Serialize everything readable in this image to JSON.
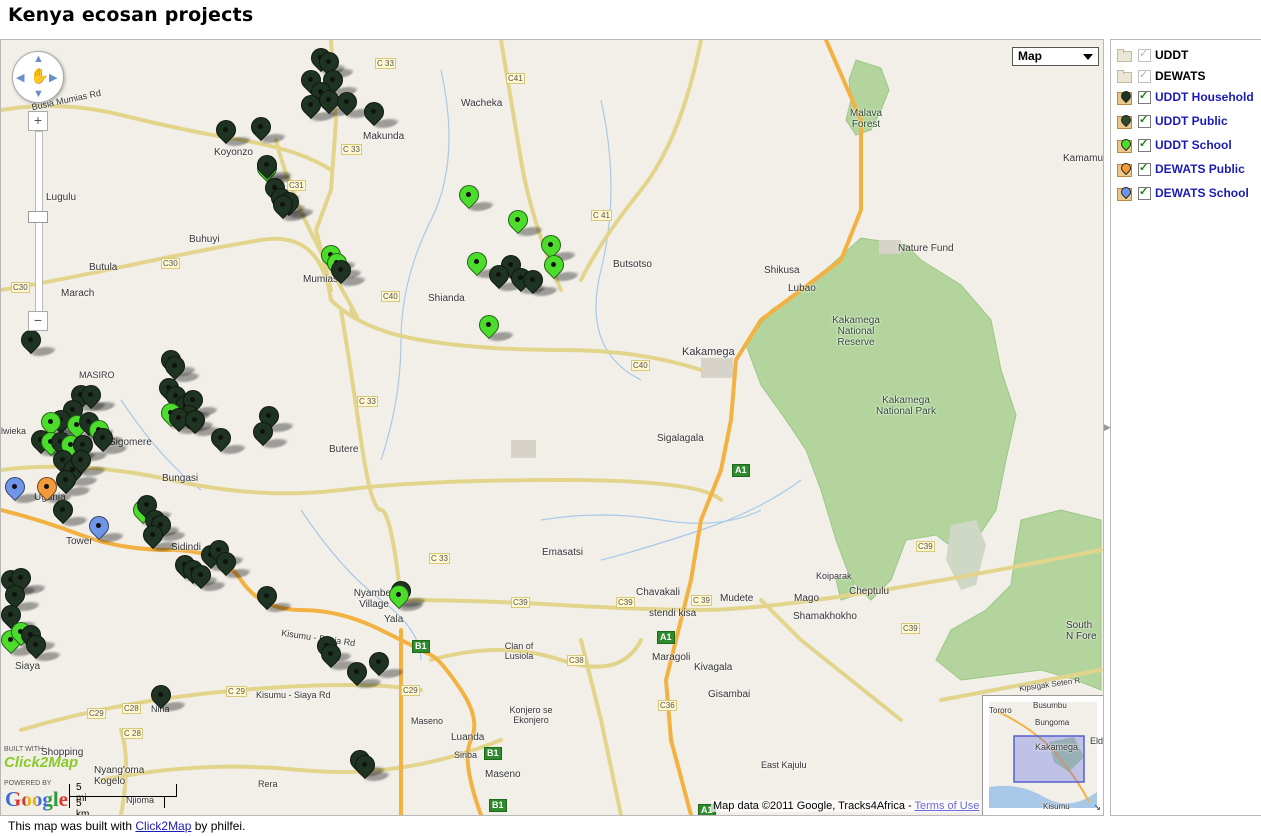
{
  "title": "Kenya ecosan projects",
  "colors": {
    "uddt_household": "#1f3322",
    "uddt_public": "#2a4a2a",
    "uddt_school": "#4cdc2c",
    "dewats_public": "#f39a3a",
    "dewats_school": "#6f95e8",
    "forest": "#b3d49d",
    "highway": "#f2b140",
    "road": "#fff3a3"
  },
  "map": {
    "type_selector": "Map",
    "attribution": "Map data ©2011 Google, Tracks4Africa - ",
    "terms_link": "Terms of Use",
    "scale_mi": "5 mi",
    "scale_km": "5 km",
    "built_with": "BUILT WITH",
    "click2map_logo": "Click2Map",
    "powered_by": "POWERED BY",
    "google_logo": "Google",
    "overview_labels": [
      "Busumbu",
      "Tororo",
      "Bungoma",
      "Kakamega",
      "Eld",
      "Kisumu"
    ],
    "places": [
      "Wacheka",
      "Makunda",
      "Koyonzo",
      "Lugulu",
      "Buhuyi",
      "Butula",
      "Marach",
      "Mumias",
      "Shianda",
      "Butsotso",
      "Lubao",
      "Shikusa",
      "Nature Fund",
      "Malava Forest",
      "Kamamu",
      "Kakamega",
      "Kakamega National Reserve",
      "Kakamega National Park",
      "MASIRO",
      "Sigomere",
      "Bungasi",
      "Butere",
      "Sigalagala",
      "Ugunja",
      "Tower",
      "Sidindi",
      "Siaya",
      "Nyamber Village",
      "Yala",
      "Emasatsi",
      "Chavakali",
      "Mudete",
      "Mago",
      "Cheptulu",
      "Koiparak",
      "Shamakhokho",
      "stendi kisa",
      "Clan of Lusiola",
      "Maragoli",
      "Kivagala",
      "Gisambai",
      "Maseno",
      "Luanda",
      "Konjero se Ekonjero",
      "Siriba",
      "Maseno",
      "East Kajulu",
      "South N Fore",
      "Nyang'oma Kogelo",
      "Shopping",
      "Rera",
      "Nina",
      "lwieka",
      "Kipsigak Seten R",
      "Njioma"
    ],
    "roads": [
      "C 33",
      "C 33",
      "C31",
      "C30",
      "C30",
      "C41",
      "C 41",
      "C40",
      "C40",
      "C 33",
      "C 33",
      "C39",
      "C39",
      "C38",
      "C39",
      "C36",
      "C 29",
      "C29",
      "C28",
      "C 28",
      "C29",
      "C 39",
      "C39",
      "Busia Mumias Rd",
      "Kisumu - Busia Rd",
      "Kisumu - Siaya Rd"
    ],
    "highways": [
      "A1",
      "A1",
      "B1",
      "B1",
      "B1",
      "A1"
    ]
  },
  "legend": [
    {
      "label": "UDDT",
      "checked": true,
      "enabled": false,
      "icon": "folder-icon"
    },
    {
      "label": "DEWATS",
      "checked": true,
      "enabled": false,
      "icon": "folder-icon"
    },
    {
      "label": "UDDT Household",
      "checked": true,
      "enabled": true,
      "icon": "dark-green-marker-icon"
    },
    {
      "label": "UDDT Public",
      "checked": true,
      "enabled": true,
      "icon": "green-marker-icon"
    },
    {
      "label": "UDDT School",
      "checked": true,
      "enabled": true,
      "icon": "light-green-marker-icon"
    },
    {
      "label": "DEWATS Public",
      "checked": true,
      "enabled": true,
      "icon": "orange-marker-icon"
    },
    {
      "label": "DEWATS School",
      "checked": true,
      "enabled": true,
      "icon": "blue-marker-icon"
    }
  ],
  "footer": {
    "prefix": "This map was built with ",
    "link": "Click2Map",
    "suffix": " by philfei."
  }
}
